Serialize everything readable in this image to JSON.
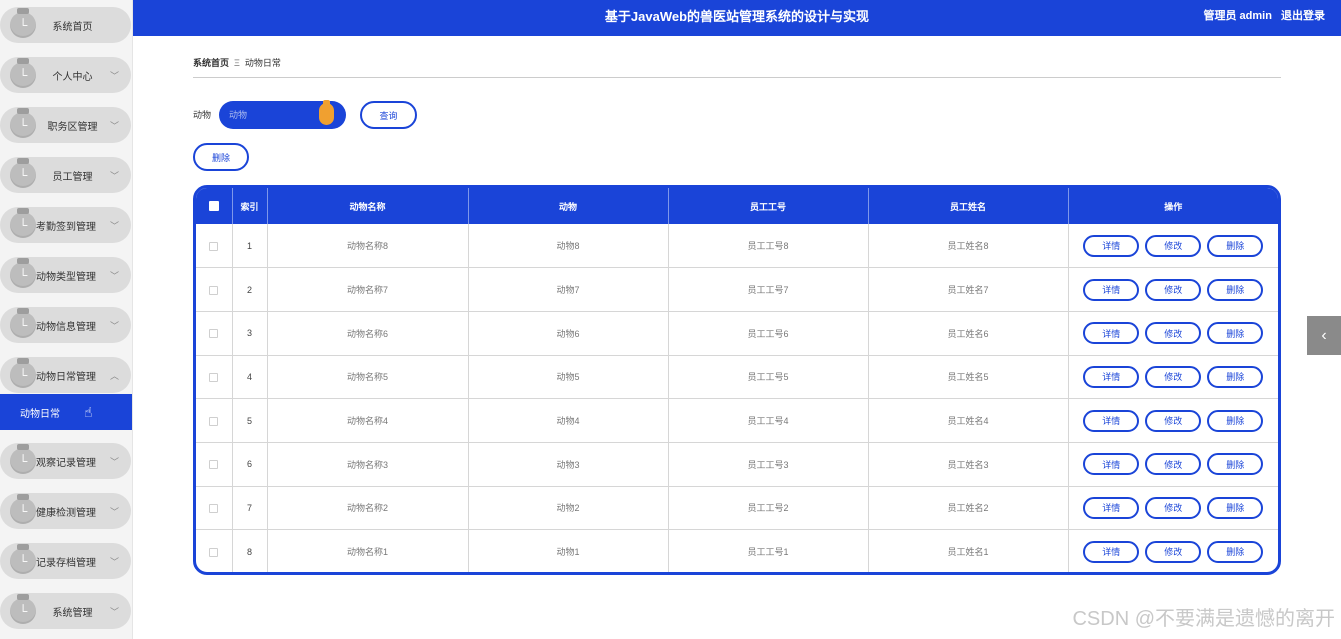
{
  "header": {
    "title": "基于JavaWeb的兽医站管理系统的设计与实现",
    "user_label": "管理员 admin",
    "logout_label": "退出登录"
  },
  "sidebar": {
    "items": [
      {
        "label": "系统首页",
        "chevron": ""
      },
      {
        "label": "个人中心",
        "chevron": "﹀"
      },
      {
        "label": "职务区管理",
        "chevron": "﹀"
      },
      {
        "label": "员工管理",
        "chevron": "﹀"
      },
      {
        "label": "考勤签到管理",
        "chevron": "﹀"
      },
      {
        "label": "动物类型管理",
        "chevron": "﹀"
      },
      {
        "label": "动物信息管理",
        "chevron": "﹀"
      },
      {
        "label": "动物日常管理",
        "chevron": "︿"
      },
      {
        "label": "观察记录管理",
        "chevron": "﹀"
      },
      {
        "label": "健康检测管理",
        "chevron": "﹀"
      },
      {
        "label": "记录存档管理",
        "chevron": "﹀"
      },
      {
        "label": "系统管理",
        "chevron": "﹀"
      }
    ],
    "badge_glyph": "└",
    "active_sub": "动物日常"
  },
  "breadcrumb": {
    "home": "系统首页",
    "separator": "Ξ",
    "current": "动物日常"
  },
  "search": {
    "label": "动物",
    "placeholder": "动物",
    "query_button": "查询"
  },
  "toolbar": {
    "delete_button": "删除"
  },
  "table": {
    "headers": [
      "",
      "索引",
      "动物名称",
      "动物",
      "员工工号",
      "员工姓名",
      "操作"
    ],
    "rows": [
      {
        "index": "1",
        "name": "动物名称8",
        "animal": "动物8",
        "emp_no": "员工工号8",
        "emp_name": "员工姓名8"
      },
      {
        "index": "2",
        "name": "动物名称7",
        "animal": "动物7",
        "emp_no": "员工工号7",
        "emp_name": "员工姓名7"
      },
      {
        "index": "3",
        "name": "动物名称6",
        "animal": "动物6",
        "emp_no": "员工工号6",
        "emp_name": "员工姓名6"
      },
      {
        "index": "4",
        "name": "动物名称5",
        "animal": "动物5",
        "emp_no": "员工工号5",
        "emp_name": "员工姓名5"
      },
      {
        "index": "5",
        "name": "动物名称4",
        "animal": "动物4",
        "emp_no": "员工工号4",
        "emp_name": "员工姓名4"
      },
      {
        "index": "6",
        "name": "动物名称3",
        "animal": "动物3",
        "emp_no": "员工工号3",
        "emp_name": "员工姓名3"
      },
      {
        "index": "7",
        "name": "动物名称2",
        "animal": "动物2",
        "emp_no": "员工工号2",
        "emp_name": "员工姓名2"
      },
      {
        "index": "8",
        "name": "动物名称1",
        "animal": "动物1",
        "emp_no": "员工工号1",
        "emp_name": "员工姓名1"
      }
    ],
    "actions": {
      "detail": "详情",
      "edit": "修改",
      "delete": "删除"
    }
  },
  "side_tab_glyph": "‹",
  "watermark": "CSDN @不要满是遗憾的离开",
  "colors": {
    "primary": "#1a44d8",
    "knob": "#f0a030",
    "sidebar_item": "#dcdcdc"
  }
}
